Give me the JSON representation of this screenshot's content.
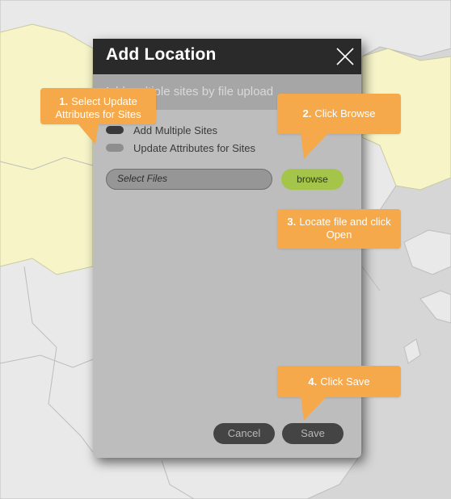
{
  "modal": {
    "title": "Add Location",
    "subheader": "Add multiple sites by file upload",
    "options": [
      {
        "label": "Add Multiple Sites",
        "selected": true
      },
      {
        "label": "Update Attributes for Sites",
        "selected": false
      }
    ],
    "file_placeholder": "Select Files",
    "browse_label": "browse",
    "cancel_label": "Cancel",
    "save_label": "Save"
  },
  "callouts": [
    {
      "step": "1.",
      "text": "Select Update Attributes for Sites"
    },
    {
      "step": "2.",
      "text": "Click Browse"
    },
    {
      "step": "3.",
      "text": "Locate file and click Open"
    },
    {
      "step": "4.",
      "text": "Click Save"
    }
  ],
  "colors": {
    "callout": "#f6a94a",
    "browse": "#a4c44a",
    "header": "#2a2a2a",
    "modal_body": "#bdbdbd",
    "map_land_highlight": "#f7f5c8",
    "map_land": "#e8e8e8",
    "map_water": "#d6d6d6"
  }
}
